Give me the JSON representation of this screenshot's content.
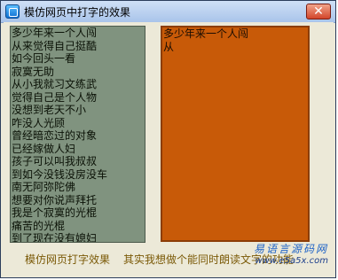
{
  "window": {
    "title": "模仿网页中打字的效果",
    "close_label": "✕"
  },
  "left_list": [
    "多少年来一个人闯",
    "从来觉得自己挺酷",
    "如今回头一看",
    "寂寞无助",
    "从小我就习文练武",
    "觉得自己是个人物",
    "没想到老天不小",
    "咋没人光顾",
    "曾经暗恋过的对象",
    "已经嫁做人妇",
    "孩子可以叫我叔叔",
    "到如今没钱没房没车",
    "南无阿弥陀佛",
    "想要对你说声拜托",
    "我是个寂寞的光棍",
    "痛苦的光棍",
    "到了现在没有媳妇"
  ],
  "right_pane": [
    "多少年来一个人闯",
    "从"
  ],
  "footer": {
    "left_label": "模仿网页打字效果",
    "right_label": "其实我想做个能同时朗读文字的功能"
  },
  "watermark": {
    "cn": "易语言源码网",
    "url": "www.e5a5x.com"
  }
}
